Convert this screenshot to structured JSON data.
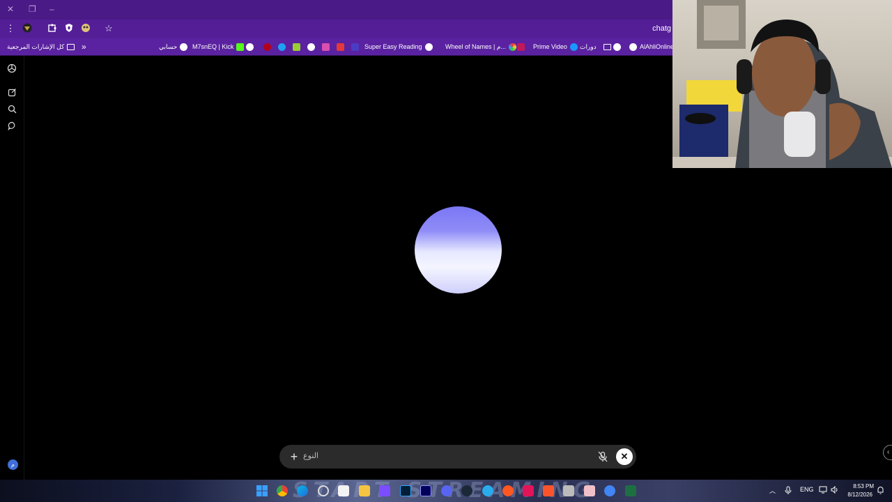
{
  "browser": {
    "url_partial": "chatg",
    "bookmarks": {
      "all_bookmarks": "كل الإشارات المرجعية",
      "chevron": "»",
      "items": [
        {
          "label": "حسابي"
        },
        {
          "label": "M7snEQ | Kick"
        },
        {
          "label": "Super Easy Reading"
        },
        {
          "label": "Wheel of Names | م..."
        },
        {
          "label": "Prime Video"
        },
        {
          "label": "دورات"
        },
        {
          "label": "AlAhliOnline"
        }
      ]
    }
  },
  "composer": {
    "placeholder_text": "النوع",
    "plus_symbol": "+",
    "close_symbol": "✕"
  },
  "sidebar": {
    "avatar_initial": "م"
  },
  "taskbar": {
    "banner_text": "START STREAMING",
    "language": "ENG",
    "time": "8:53 PM",
    "date": "8/12/2026"
  },
  "colors": {
    "titlebar": "#4a1a86",
    "toolbar": "#541e97",
    "bookmarks_bar": "#5a22a0",
    "orb_top": "#7a77f5",
    "orb_bottom": "#f4f5ff"
  }
}
